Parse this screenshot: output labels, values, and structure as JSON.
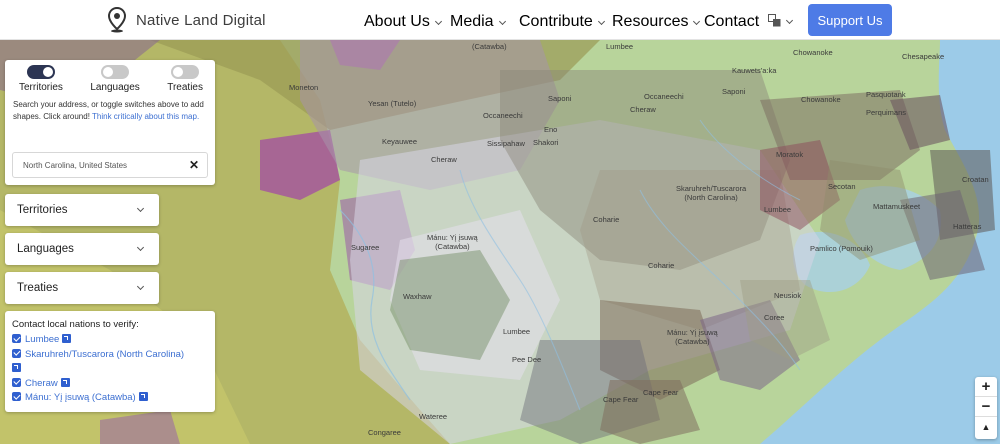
{
  "header": {
    "brand": "Native Land Digital",
    "nav": [
      "About Us",
      "Media",
      "Contribute",
      "Resources",
      "Contact"
    ],
    "support_label": "Support Us"
  },
  "toggles": [
    {
      "label": "Territories",
      "on": true
    },
    {
      "label": "Languages",
      "on": false
    },
    {
      "label": "Treaties",
      "on": false
    }
  ],
  "help": {
    "text": "Search your address, or toggle switches above to add shapes. Click around! ",
    "link": "Think critically about this map."
  },
  "search": {
    "value": "North Carolina, United States"
  },
  "accordions": [
    "Territories",
    "Languages",
    "Treaties"
  ],
  "contact": {
    "title": "Contact local nations to verify:",
    "items": [
      "Lumbee",
      "Skaruhreh/Tuscarora (North Carolina)",
      "Cheraw",
      "Mánu: Yį įsuwą (Catawba)"
    ]
  },
  "map_labels": [
    "(Catawba)",
    "Lumbee",
    "Chowanoke",
    "Chesapeake",
    "Kauwets'a:ka",
    "Moneton",
    "Yesan (Tutelo)",
    "Saponi",
    "Occaneechi",
    "Saponi",
    "Chowanoke",
    "Pasquotank",
    "Cheraw",
    "Perquimans",
    "Occaneechi",
    "Eno",
    "Keyauwee",
    "Shakori",
    "Sissipahaw",
    "Moratok",
    "Cheraw",
    "Skaruhreh/Tuscarora\n(North Carolina)",
    "Secotan",
    "Croatan",
    "Mattamuskeet",
    "Lumbee",
    "Coharie",
    "Hatteras",
    "Sugaree",
    "Mánu: Yį įsuwą\n(Catawba)",
    "Pamlico (Pomouik)",
    "Coharie",
    "Neusiok",
    "Waxhaw",
    "Coree",
    "Lumbee",
    "Mánu: Yį įsuwą\n(Catawba)",
    "Pee Dee",
    "Cape Fear",
    "Cape Fear",
    "Wateree",
    "Congaree"
  ],
  "zoom": {
    "in": "+",
    "out": "−",
    "reset": "▲"
  },
  "colors": {
    "accent": "#4e7be6",
    "toggle_on": "#2c3553",
    "link": "#3c6fd1",
    "water": "#9ccbe8"
  }
}
